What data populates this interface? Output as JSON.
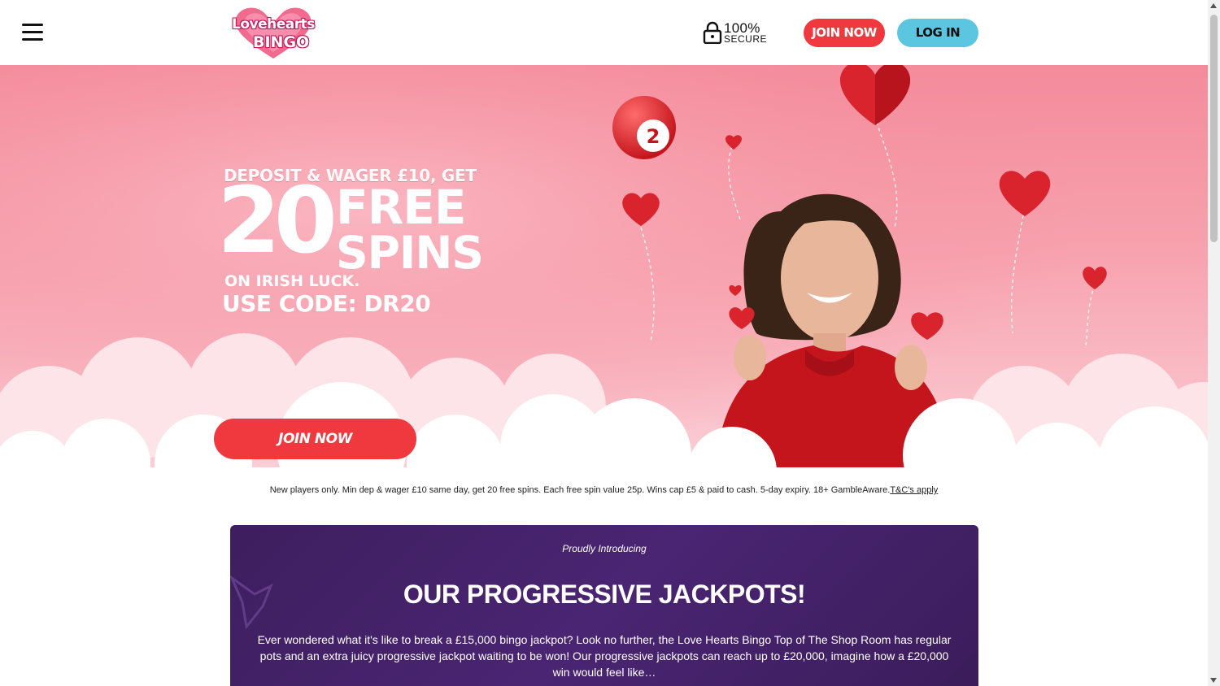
{
  "header": {
    "logo_top": "Lovehearts",
    "logo_bottom": "BINGO",
    "secure_percent": "100%",
    "secure_label": "SECURE",
    "join_label": "JOIN NOW",
    "login_label": "LOG IN"
  },
  "hero": {
    "line1": "DEPOSIT & WAGER £10, GET",
    "big_number": "20",
    "free": "FREE",
    "spins": "SPINS",
    "on": "ON IRISH LUCK.",
    "code": "USE CODE: DR20",
    "join_label": "JOIN NOW",
    "bingo_ball_number": "2"
  },
  "terms": {
    "text": "New players only. Min dep & wager £10 same day, get 20 free spins. Each free spin value 25p. Wins cap £5 & paid to cash. 5-day expiry. 18+ GambleAware.",
    "link": "T&C's apply"
  },
  "jackpot": {
    "intro": "Proudly Introducing",
    "title": "OUR PROGRESSIVE JACKPOTS!",
    "body": "Ever wondered what it's like to break a £15,000 bingo jackpot? Look no further, the Love Hearts Bingo Top of The Shop Room has regular pots and an extra juicy progressive jackpot waiting to be won! Our progressive jackpots can reach up to £20,000, imagine how a £20,000 win would feel like…"
  },
  "colors": {
    "accent_red": "#f0383f",
    "accent_blue": "#5cc6e0",
    "card_purple": "#4a2573",
    "hero_pink": "#f48b9b"
  },
  "icons": [
    "menu-icon",
    "lock-icon",
    "heart-balloon-icon",
    "bingo-ball-icon"
  ]
}
